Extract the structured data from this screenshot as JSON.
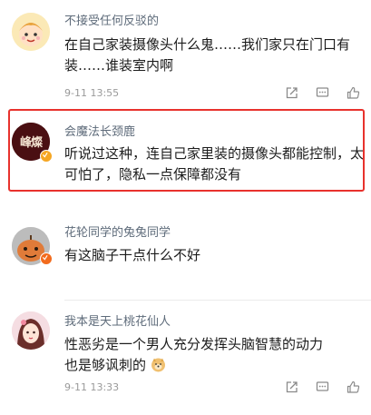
{
  "comments": [
    {
      "username": "不接受任何反驳的",
      "text": "在自己家装摄像头什么鬼……我们家只在门口有装……谁装室内啊",
      "date": "9-11 13:55"
    },
    {
      "username": "会魔法长颈鹿",
      "avatar_text": "峰燦",
      "verified": true,
      "highlighted": true,
      "text": "听说过这种，连自己家里装的摄像头都能控制，太可怕了，隐私一点保障都没有"
    },
    {
      "username": "花轮同学的兔兔同学",
      "text": "有这脑子干点什么不好"
    },
    {
      "username": "我本是天上桃花仙人",
      "text_line1": "性恶劣是一个男人充分发挥头脑智慧的动力",
      "text_line2": "也是够讽刺的",
      "text_emoji": "doge-emoji",
      "date": "9-11 13:33"
    }
  ],
  "actions": [
    "share-icon",
    "comment-icon",
    "like-icon"
  ],
  "colors": {
    "highlight_border": "#e8322d",
    "username": "#5e6b7a",
    "text": "#1c1c1c",
    "date": "#9a9a9a",
    "verified_badge": "#f5a623"
  }
}
